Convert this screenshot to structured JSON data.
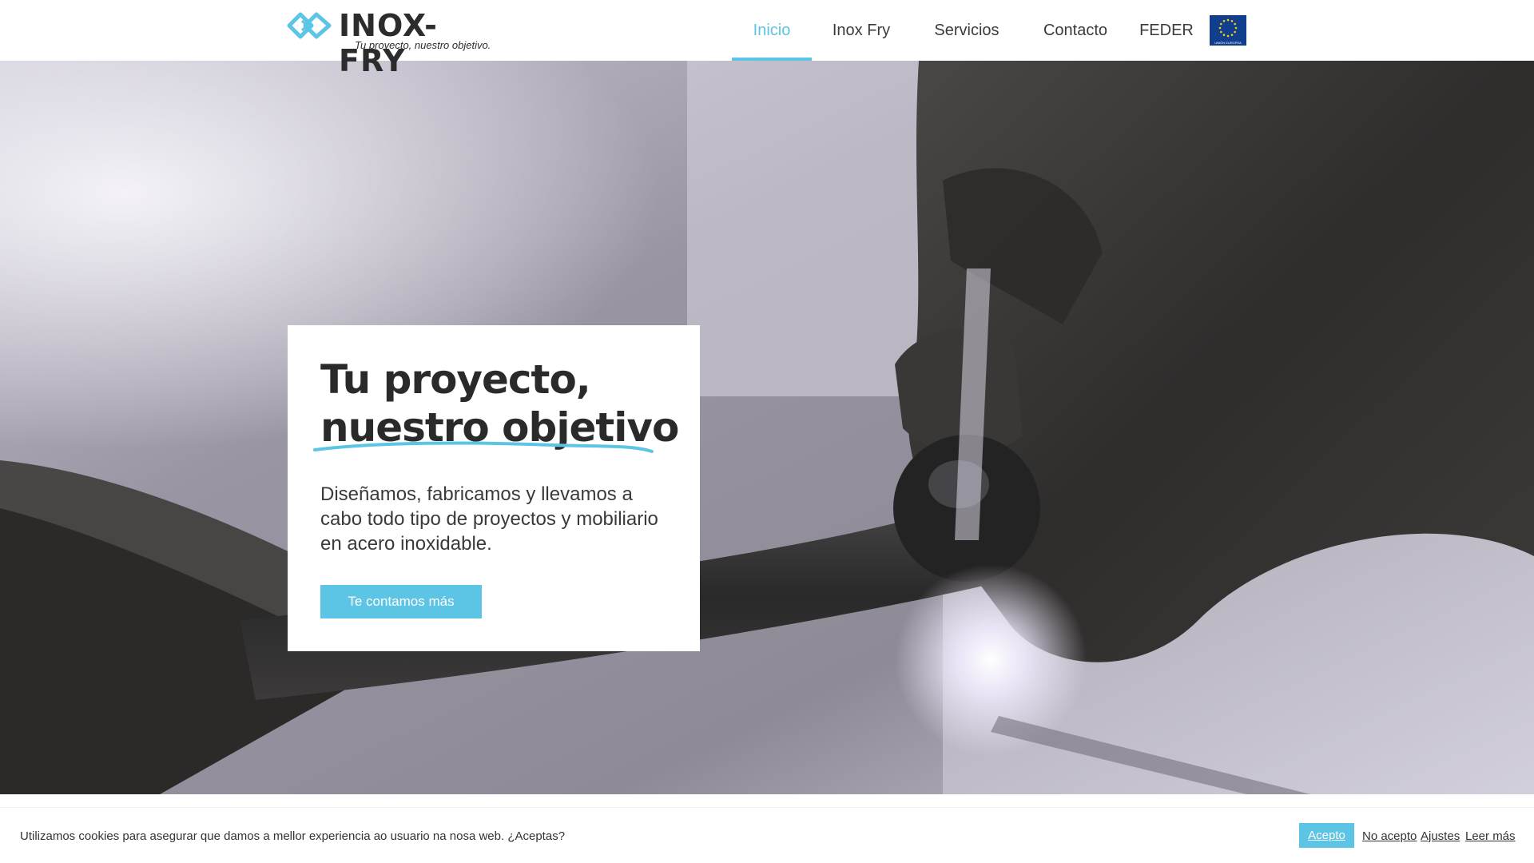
{
  "brand": {
    "name": "INOX-FRY",
    "tagline": "Tu proyecto, nuestro objetivo.",
    "eu_caption": "UNIÓN EUROPEA"
  },
  "nav": {
    "items": [
      {
        "label": "Inicio",
        "active": true
      },
      {
        "label": "Inox Fry",
        "active": false
      },
      {
        "label": "Servicios",
        "active": false
      },
      {
        "label": "Contacto",
        "active": false
      },
      {
        "label": "FEDER",
        "active": false
      }
    ]
  },
  "hero": {
    "title_line1": "Tu proyecto,",
    "title_line2": "nuestro objetivo",
    "text": "Diseñamos, fabricamos y llevamos a cabo todo tipo de proyectos y mobiliario en acero inoxidable.",
    "button_label": "Te contamos más"
  },
  "cookies": {
    "message": "Utilizamos cookies para asegurar que damos a mellor experiencia ao usuario na nosa web. ¿Aceptas?",
    "accept_label": "Acepto",
    "reject_label": "No acepto",
    "settings_label": "Ajustes",
    "more_label": "Leer más"
  },
  "colors": {
    "accent": "#5cc4e4",
    "text": "#2a2a2a",
    "eu_blue": "#123e8e"
  }
}
